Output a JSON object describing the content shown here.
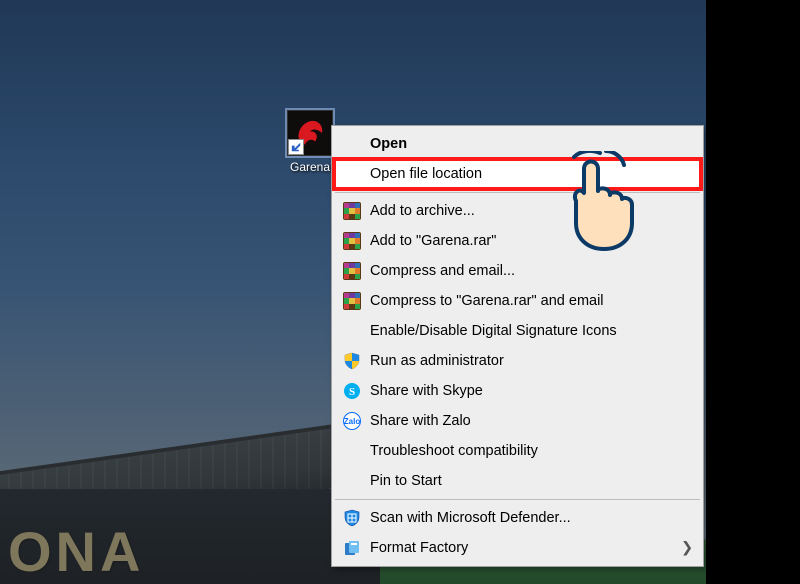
{
  "shortcut": {
    "label": "Garena",
    "icon_name": "garena-dragon-icon"
  },
  "desktop": {
    "banner_text": "ONA"
  },
  "context_menu": {
    "items": [
      {
        "label": "Open",
        "bold": true,
        "icon": null,
        "submenu": false
      },
      {
        "label": "Open file location",
        "bold": false,
        "icon": null,
        "submenu": false,
        "highlighted": true
      },
      {
        "label": "Add to archive...",
        "bold": false,
        "icon": "winrar",
        "submenu": false
      },
      {
        "label": "Add to \"Garena.rar\"",
        "bold": false,
        "icon": "winrar",
        "submenu": false
      },
      {
        "label": "Compress and email...",
        "bold": false,
        "icon": "winrar",
        "submenu": false
      },
      {
        "label": "Compress to \"Garena.rar\" and email",
        "bold": false,
        "icon": "winrar",
        "submenu": false
      },
      {
        "label": "Enable/Disable Digital Signature Icons",
        "bold": false,
        "icon": null,
        "submenu": false
      },
      {
        "label": "Run as administrator",
        "bold": false,
        "icon": "shield",
        "submenu": false
      },
      {
        "label": "Share with Skype",
        "bold": false,
        "icon": "skype",
        "submenu": false
      },
      {
        "label": "Share with Zalo",
        "bold": false,
        "icon": "zalo",
        "submenu": false
      },
      {
        "label": "Troubleshoot compatibility",
        "bold": false,
        "icon": null,
        "submenu": false
      },
      {
        "label": "Pin to Start",
        "bold": false,
        "icon": null,
        "submenu": false
      },
      {
        "label": "Scan with Microsoft Defender...",
        "bold": false,
        "icon": "defender",
        "submenu": false
      },
      {
        "label": "Format Factory",
        "bold": false,
        "icon": "formatfactory",
        "submenu": true
      }
    ],
    "separators_after_index": [
      1,
      11
    ]
  },
  "annotation": {
    "highlight_color": "#ff1a1a"
  }
}
